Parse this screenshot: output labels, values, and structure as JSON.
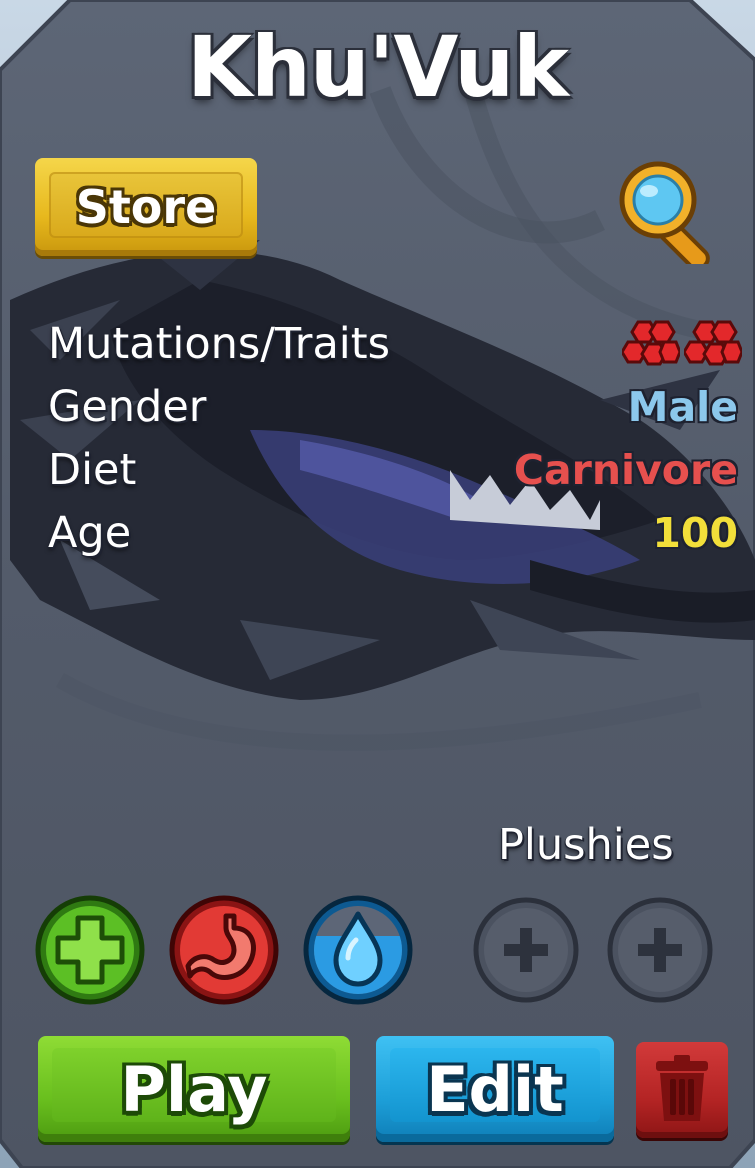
{
  "creature": {
    "name": "Khu'Vuk"
  },
  "header": {
    "store_label": "Store",
    "search_icon": "magnifying-glass-icon"
  },
  "stats": {
    "rows": [
      {
        "label": "Mutations/Traits",
        "value": "",
        "icon": "red-cluster-mutation-icon",
        "count": 2
      },
      {
        "label": "Gender",
        "value": "Male",
        "color": "#8cc8ec"
      },
      {
        "label": "Diet",
        "value": "Carnivore",
        "color": "#e6504e"
      },
      {
        "label": "Age",
        "value": "100",
        "color": "#f2df3a"
      }
    ]
  },
  "needs": {
    "health_icon": "green-plus-health-icon",
    "hunger_icon": "stomach-hunger-icon",
    "thirst_icon": "water-drop-thirst-icon",
    "thirst_fill": 0.65
  },
  "plushies": {
    "label": "Plushies",
    "slots": 2
  },
  "actions": {
    "play_label": "Play",
    "edit_label": "Edit",
    "delete_icon": "trash-can-icon"
  },
  "colors": {
    "card_bg": "#555e6d",
    "store_yellow": "#e7b81d",
    "play_green": "#69bf1e",
    "edit_blue": "#1d9fd8",
    "delete_red": "#b42424"
  }
}
